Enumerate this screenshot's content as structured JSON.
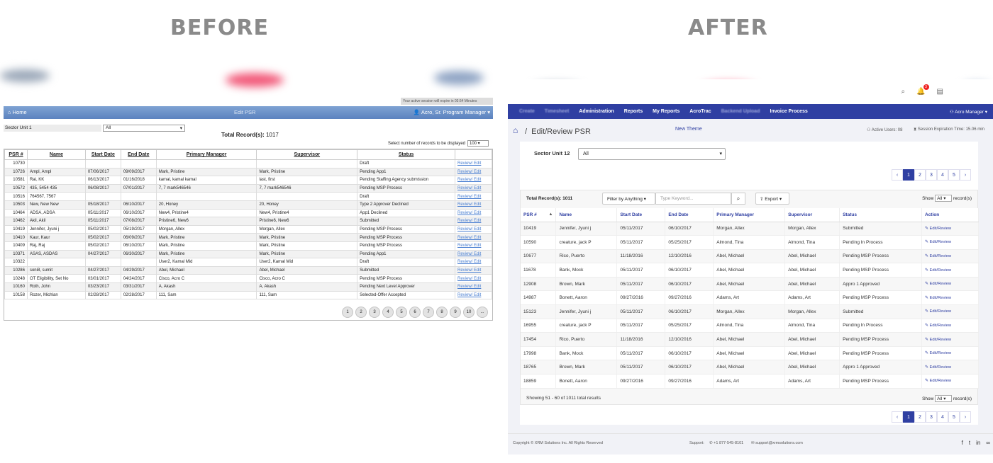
{
  "labels": {
    "before": "BEFORE",
    "after": "AFTER"
  },
  "before": {
    "session_text": "Your active session will expire in 03:54 Minutes",
    "nav": {
      "home": "Home",
      "title": "Edit PSR",
      "user": "Acro, Sr. Program Manager"
    },
    "filter": {
      "label": "Sector Unit 1",
      "value": "All"
    },
    "total_label": "Total Record(s):",
    "total_value": "1017",
    "perpage_label": "Select number of records to be displayed",
    "perpage_value": "100",
    "columns": [
      "PSR #",
      "Name",
      "Start Date",
      "End Date",
      "Primary Manager",
      "Supervisor",
      "Status",
      ""
    ],
    "rows": [
      [
        "10730",
        "",
        "",
        "",
        "",
        "",
        "Draft",
        "Review/ Edit"
      ],
      [
        "10726",
        "Ampl, Ampl",
        "07/06/2017",
        "09/09/2017",
        "Mark, Pristine",
        "Mark, Pristine",
        "Pending App1",
        "Review/ Edit"
      ],
      [
        "10581",
        "Rai, KK",
        "06/13/2017",
        "01/16/2018",
        "kamal, kamal kamal",
        "last, first",
        "Pending Staffing Agency submission",
        "Review/ Edit"
      ],
      [
        "10572",
        "435, 5454 435",
        "06/08/2017",
        "07/01/2017",
        "7, 7 mark546546",
        "7, 7 mark546546",
        "Pending MSP Process",
        "Review/ Edit"
      ],
      [
        "10516",
        "764567, 7567",
        "",
        "",
        "",
        "",
        "Draft",
        "Review/ Edit"
      ],
      [
        "10503",
        "New, New New",
        "05/18/2017",
        "06/10/2017",
        "20, Honey",
        "20, Honey",
        "Type 2 Approver Declined",
        "Review/ Edit"
      ],
      [
        "10464",
        "ADSA, ADSA",
        "05/11/2017",
        "06/10/2017",
        "New4, Pristine4",
        "New4, Pristine4",
        "App1 Declined",
        "Review/ Edit"
      ],
      [
        "10462",
        "Akil, Akil",
        "05/11/2017",
        "07/08/2017",
        "Pristine6, New6",
        "Pristine6, New6",
        "Submitted",
        "Review/ Edit"
      ],
      [
        "10419",
        "Jennifer, Jyuni j",
        "05/02/2017",
        "05/19/2017",
        "Morgan, Allex",
        "Morgan, Allex",
        "Pending MSP Process",
        "Review/ Edit"
      ],
      [
        "10410",
        "Kaur, Kaur",
        "05/02/2017",
        "06/09/2017",
        "Mark, Pristine",
        "Mark, Pristine",
        "Pending MSP Process",
        "Review/ Edit"
      ],
      [
        "10409",
        "Raj, Raj",
        "05/02/2017",
        "06/10/2017",
        "Mark, Pristine",
        "Mark, Pristine",
        "Pending MSP Process",
        "Review/ Edit"
      ],
      [
        "10371",
        "ASAS, ASDAS",
        "04/27/2017",
        "06/30/2017",
        "Mark, Pristine",
        "Mark, Pristine",
        "Pending App1",
        "Review/ Edit"
      ],
      [
        "10322",
        "",
        "",
        "",
        "User2, Kamal Mid",
        "User2, Kamal Mid",
        "Draft",
        "Review/ Edit"
      ],
      [
        "10286",
        "soni8, sumit",
        "04/27/2017",
        "04/29/2017",
        "Abel, Michael",
        "Abel, Michael",
        "Submitted",
        "Review/ Edit"
      ],
      [
        "10248",
        "OT Eligibility, Set No",
        "03/01/2017",
        "04/24/2017",
        "Cisco, Acro C",
        "Cisco, Acro C",
        "Pending MSP Process",
        "Review/ Edit"
      ],
      [
        "10160",
        "Roth, John",
        "03/23/2017",
        "03/31/2017",
        "A, Akash",
        "A, Akash",
        "Pending Next Level Approver",
        "Review/ Edit"
      ],
      [
        "10158",
        "Rozer, Michlan",
        "02/28/2017",
        "02/28/2017",
        "111, Sam",
        "111, Sam",
        "Selected-Offer Accepted",
        "Review/ Edit"
      ]
    ],
    "pages": [
      "1",
      "2",
      "3",
      "4",
      "5",
      "6",
      "7",
      "8",
      "9",
      "10",
      "..."
    ]
  },
  "after": {
    "nav_items": [
      {
        "label": "Create",
        "muted": true
      },
      {
        "label": "Timesheet",
        "muted": true
      },
      {
        "label": "Administration"
      },
      {
        "label": "Reports"
      },
      {
        "label": "My Reports"
      },
      {
        "label": "AcroTrac"
      },
      {
        "label": "Backend Upload",
        "muted": true
      },
      {
        "label": "Invoice Process"
      }
    ],
    "user": "Acro Manager",
    "notif_count": "3",
    "page_title": "Edit/Review PSR",
    "new_theme": "New Theme",
    "active_users": "Active Users: 08",
    "session": "Session Expiration Time: 15.06 min",
    "sector_label": "Sector Unit 12",
    "sector_value": "All",
    "pages": [
      "1",
      "2",
      "3",
      "4",
      "5"
    ],
    "total": "Total Record(s): 1011",
    "filter_btn": "Filter by Anything",
    "keyword_placeholder": "Type Keyword...",
    "export": "Export",
    "show_label": "Show",
    "show_value": "All",
    "records_label": "record(s)",
    "columns": [
      "PSR #",
      "Name",
      "Start Date",
      "End Date",
      "Primary Manager",
      "Supervisor",
      "Status",
      "Action"
    ],
    "rows": [
      [
        "10419",
        "Jennifer, Jyuni j",
        "05/11/2017",
        "06/10/2017",
        "Morgan, Allex",
        "Morgan, Allex",
        "Submitted",
        "Edit/Review"
      ],
      [
        "10590",
        "creature, jack P",
        "05/11/2017",
        "05/25/2017",
        "Almond, Tina",
        "Almond, Tina",
        "Pending In Process",
        "Edit/Review"
      ],
      [
        "10677",
        "Rico, Puerto",
        "11/18/2016",
        "12/10/2016",
        "Abel, Michael",
        "Abel, Michael",
        "Pending MSP Process",
        "Edit/Review"
      ],
      [
        "11678",
        "Bank, Mock",
        "05/11/2017",
        "06/10/2017",
        "Abel, Michael",
        "Abel, Michael",
        "Pending MSP Process",
        "Edit/Review"
      ],
      [
        "12908",
        "Brown, Mark",
        "05/11/2017",
        "06/10/2017",
        "Abel, Michael",
        "Abel, Michael",
        "Appro 1 Approved",
        "Edit/Review"
      ],
      [
        "14987",
        "Bonett, Aaron",
        "09/27/2016",
        "09/27/2016",
        "Adams, Art",
        "Adams, Art",
        "Pending MSP Process",
        "Edit/Review"
      ],
      [
        "15123",
        "Jennifer, Jyuni j",
        "05/11/2017",
        "06/10/2017",
        "Morgan, Allex",
        "Morgan, Allex",
        "Submitted",
        "Edit/Review"
      ],
      [
        "16955",
        "creature, jack P",
        "05/11/2017",
        "05/25/2017",
        "Almond, Tina",
        "Almond, Tina",
        "Pending In Process",
        "Edit/Review"
      ],
      [
        "17454",
        "Rico, Puerto",
        "11/18/2016",
        "12/10/2016",
        "Abel, Michael",
        "Abel, Michael",
        "Pending MSP Process",
        "Edit/Review"
      ],
      [
        "17998",
        "Bank, Mock",
        "05/11/2017",
        "06/10/2017",
        "Abel, Michael",
        "Abel, Michael",
        "Pending MSP Process",
        "Edit/Review"
      ],
      [
        "18765",
        "Brown, Mark",
        "05/11/2017",
        "06/10/2017",
        "Abel, Michael",
        "Abel, Michael",
        "Appro 1 Approved",
        "Edit/Review"
      ],
      [
        "18859",
        "Bonett, Aaron",
        "09/27/2016",
        "09/27/2016",
        "Adams, Art",
        "Adams, Art",
        "Pending MSP Process",
        "Edit/Review"
      ]
    ],
    "showing": "Showing 51 - 60 of 1011 total results",
    "footer": {
      "copyright": "Copyright © XRM Solutions Inc. All Rights Reserved",
      "support": "Support:",
      "phone": "+1 877-545-8101",
      "email": "support@xrmsolutions.com"
    }
  }
}
